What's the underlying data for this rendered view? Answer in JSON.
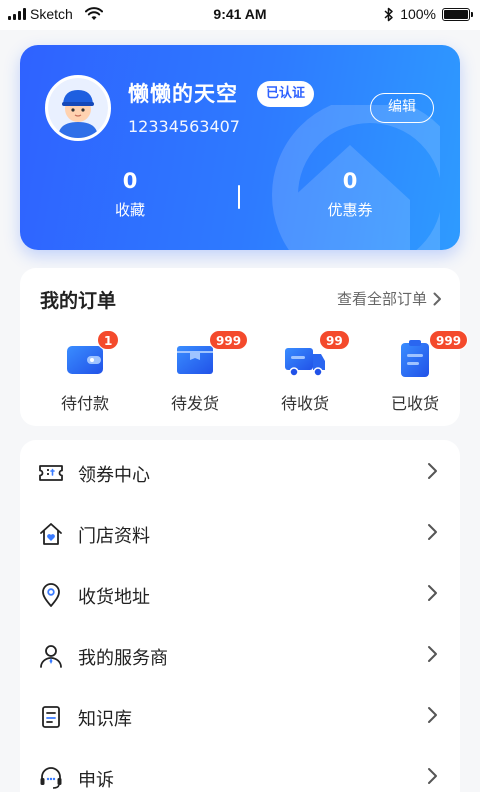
{
  "status_bar": {
    "carrier": "Sketch",
    "time": "9:41 AM",
    "battery": "100%"
  },
  "profile": {
    "username": "懒懒的天空",
    "verified_badge": "已认证",
    "phone": "12334563407",
    "edit_label": "编辑",
    "stats": [
      {
        "value": "0",
        "label": "收藏"
      },
      {
        "value": "0",
        "label": "优惠券"
      }
    ],
    "colors": {
      "gradient_start": "#2f62ff",
      "gradient_end": "#2e9bff"
    }
  },
  "orders": {
    "title": "我的订单",
    "view_all": "查看全部订单",
    "items": [
      {
        "label": "待付款",
        "badge": "1",
        "icon": "wallet-icon"
      },
      {
        "label": "待发货",
        "badge": "999",
        "icon": "package-icon"
      },
      {
        "label": "待收货",
        "badge": "99",
        "icon": "truck-icon"
      },
      {
        "label": "已收货",
        "badge": "999",
        "icon": "clipboard-icon"
      }
    ]
  },
  "menu": {
    "items": [
      {
        "label": "领券中心",
        "icon": "ticket-icon"
      },
      {
        "label": "门店资料",
        "icon": "store-icon"
      },
      {
        "label": "收货地址",
        "icon": "location-pin-icon"
      },
      {
        "label": "我的服务商",
        "icon": "user-icon"
      },
      {
        "label": "知识库",
        "icon": "book-icon"
      },
      {
        "label": "申诉",
        "icon": "headset-icon"
      }
    ]
  }
}
